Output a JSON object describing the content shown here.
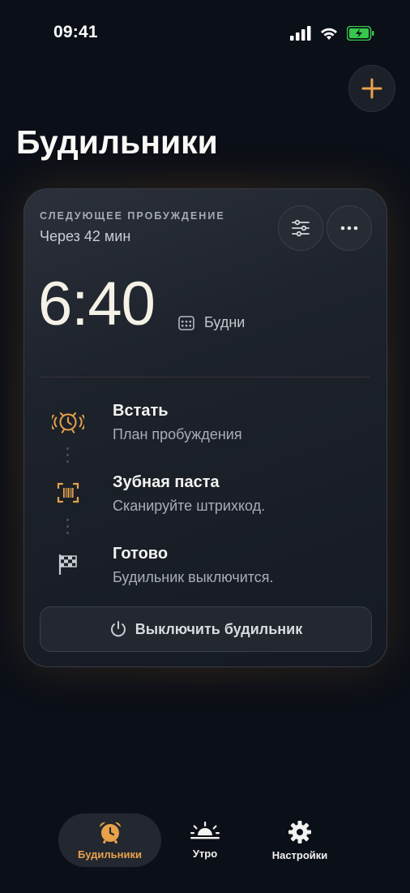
{
  "status_bar": {
    "time": "09:41",
    "icons": [
      "signal-icon",
      "wifi-icon",
      "battery-charging-icon"
    ]
  },
  "header": {
    "title": "Будильники",
    "add_icon": "plus-icon"
  },
  "colors": {
    "accent": "#e8a24a",
    "background": "#0b0f17",
    "battery": "#35c84a"
  },
  "next_alarm": {
    "label": "СЛЕДУЮЩЕЕ ПРОБУЖДЕНИЕ",
    "countdown": "Через 42 мин",
    "time": "6:40",
    "repeat": "Будни",
    "settings_icon": "sliders-icon",
    "more_icon": "more-dots-icon",
    "steps": [
      {
        "title": "Встать",
        "description": "План пробуждения",
        "icon": "alarm-ringing-icon"
      },
      {
        "title": "Зубная паста",
        "description": "Сканируйте штрихкод.",
        "icon": "barcode-scan-icon"
      },
      {
        "title": "Готово",
        "description": "Будильник выключится.",
        "icon": "checkered-flag-icon"
      }
    ],
    "off_button": "Выключить будильник"
  },
  "tabbar": {
    "tabs": [
      {
        "label": "Будильники",
        "icon": "alarm-clock-icon",
        "active": true
      },
      {
        "label": "Утро",
        "icon": "sunrise-icon",
        "active": false
      },
      {
        "label": "Настройки",
        "icon": "gear-icon",
        "active": false
      }
    ]
  }
}
